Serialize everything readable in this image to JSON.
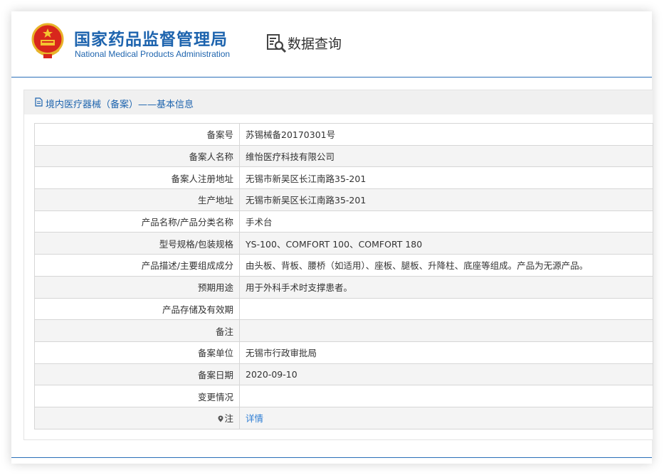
{
  "header": {
    "title_cn": "国家药品监督管理局",
    "title_en": "National Medical Products Administration",
    "section": "数据查询",
    "emblem_icon": "national-emblem-icon",
    "query_icon": "document-search-icon",
    "brand_color": "#1e64ae"
  },
  "panel": {
    "title": "境内医疗器械（备案）——基本信息",
    "title_icon": "document-icon"
  },
  "rows": [
    {
      "label": "备案号",
      "value": "苏锡械备20170301号"
    },
    {
      "label": "备案人名称",
      "value": "维怡医疗科技有限公司"
    },
    {
      "label": "备案人注册地址",
      "value": "无锡市新吴区长江南路35-201"
    },
    {
      "label": "生产地址",
      "value": "无锡市新吴区长江南路35-201"
    },
    {
      "label": "产品名称/产品分类名称",
      "value": "手术台"
    },
    {
      "label": "型号规格/包装规格",
      "value": "YS-100、COMFORT 100、COMFORT 180"
    },
    {
      "label": "产品描述/主要组成成分",
      "value": "由头板、背板、腰桥（如适用）、座板、腿板、升降柱、底座等组成。产品为无源产品。"
    },
    {
      "label": "预期用途",
      "value": "用于外科手术时支撑患者。"
    },
    {
      "label": "产品存储及有效期",
      "value": ""
    },
    {
      "label": "备注",
      "value": ""
    },
    {
      "label": "备案单位",
      "value": "无锡市行政审批局"
    },
    {
      "label": "备案日期",
      "value": "2020-09-10"
    },
    {
      "label": "变更情况",
      "value": ""
    },
    {
      "label": "注",
      "value": "详情",
      "label_icon": "pin-icon",
      "link_color": "#2b7cd3"
    }
  ]
}
